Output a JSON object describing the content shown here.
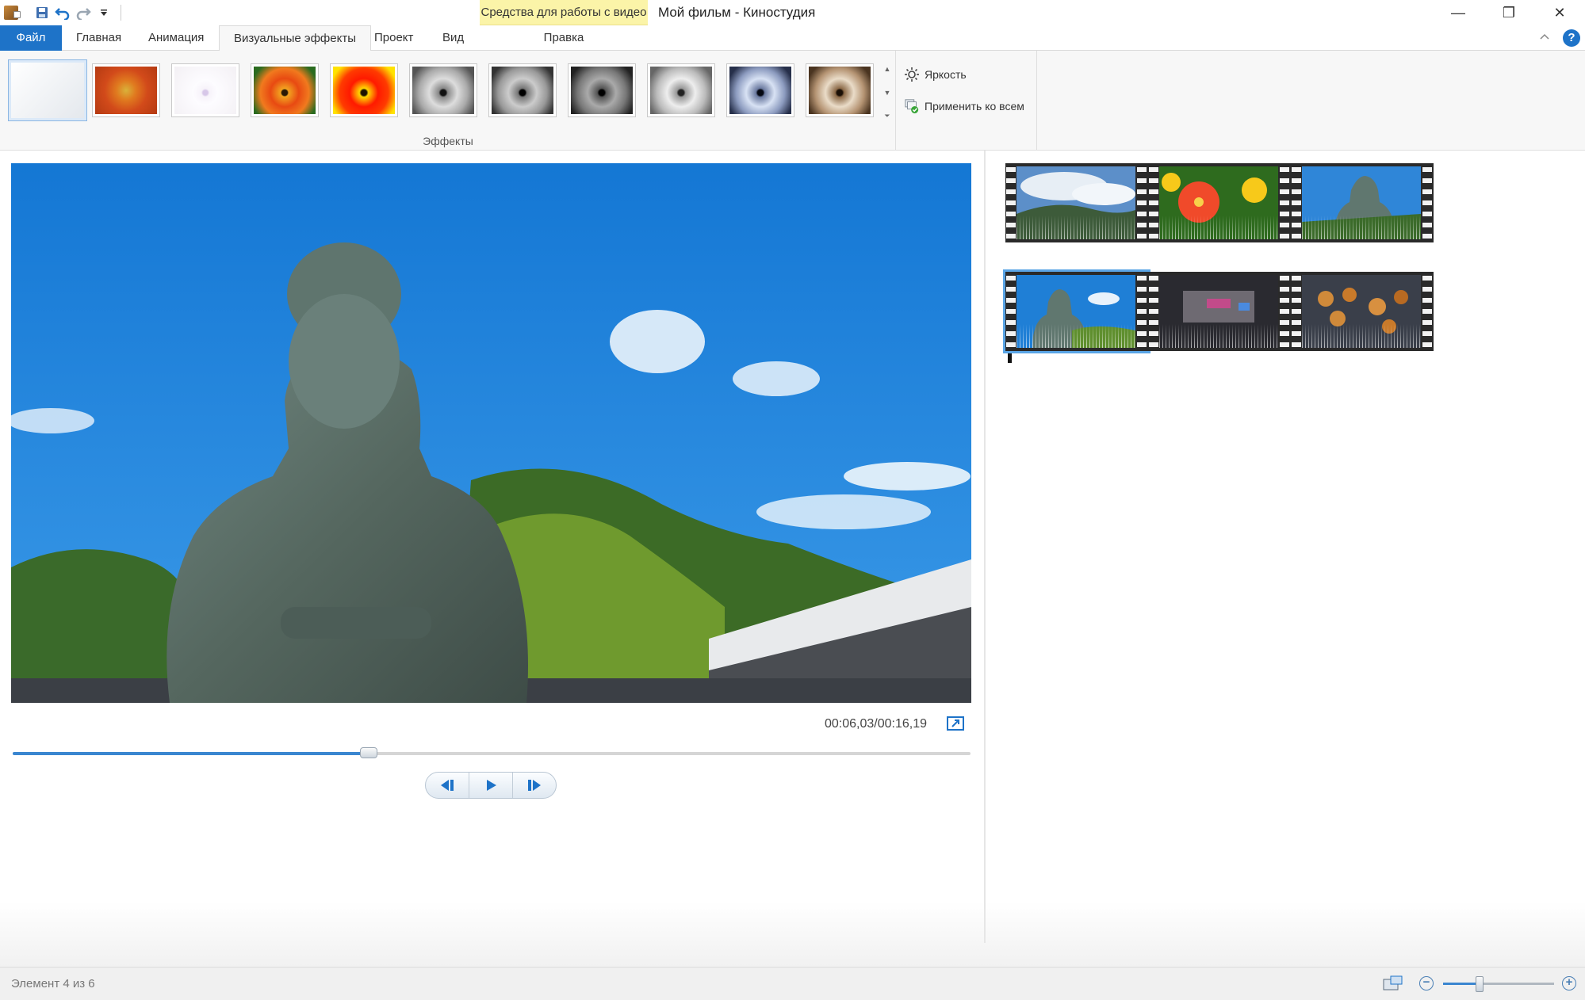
{
  "window": {
    "title": "Мой фильм - Киностудия",
    "context_group": "Средства для работы с видео"
  },
  "window_controls": {
    "minimize": "—",
    "restore": "❐",
    "close": "✕"
  },
  "tabs": [
    {
      "label": "Файл"
    },
    {
      "label": "Главная"
    },
    {
      "label": "Анимация"
    },
    {
      "label": "Визуальные эффекты"
    },
    {
      "label": "Проект"
    },
    {
      "label": "Вид"
    },
    {
      "label": "Правка"
    }
  ],
  "active_tab": "Визуальные эффекты",
  "ribbon": {
    "effects_group_label": "Эффекты",
    "effect_thumbnails": [
      {
        "icon": "no-effect",
        "selected": true
      },
      {
        "icon": "blur-effect"
      },
      {
        "icon": "edge-detect-effect"
      },
      {
        "icon": "warm-effect"
      },
      {
        "icon": "saturated-effect"
      },
      {
        "icon": "grayscale-effect"
      },
      {
        "icon": "grayscale-contrast-effect"
      },
      {
        "icon": "dark-grayscale-effect"
      },
      {
        "icon": "light-grayscale-effect"
      },
      {
        "icon": "cyan-tone-effect"
      },
      {
        "icon": "sepia-effect"
      }
    ],
    "brightness_label": "Яркость",
    "apply_all_label": "Применить ко всем",
    "help": "?"
  },
  "player": {
    "timecode": "00:06,03/00:16,19",
    "progress": 0.372
  },
  "storyboard": {
    "rows": [
      [
        "landscape-clouds",
        "red-flowers",
        "buddha-statue"
      ],
      [
        "buddha-statue-selected",
        "night-street-sign",
        "lanterns"
      ]
    ],
    "selected_item": 4,
    "total_items": 6
  },
  "status": {
    "text": "Элемент 4 из 6",
    "zoom_minus": "−",
    "zoom_plus": "+",
    "zoom_level": 0.33
  },
  "colors": {
    "accent": "#1e73c8",
    "context_tab": "#fbf4a8"
  }
}
